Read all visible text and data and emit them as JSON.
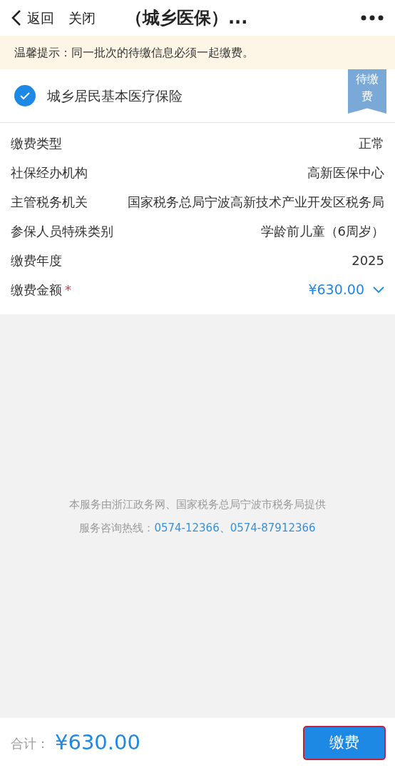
{
  "nav": {
    "back": "返回",
    "close": "关闭",
    "title": "（城乡医保）..."
  },
  "notice": "温馨提示：同一批次的待缴信息必须一起缴费。",
  "item": {
    "name": "城乡居民基本医疗保险",
    "checked": true,
    "ribbon": "待缴费"
  },
  "details": [
    {
      "label": "缴费类型",
      "value": "正常",
      "kind": "plain"
    },
    {
      "label": "社保经办机构",
      "value": "高新医保中心",
      "kind": "plain"
    },
    {
      "label": "主管税务机关",
      "value": "国家税务总局宁波高新技术产业开发区税务局",
      "kind": "plain"
    },
    {
      "label": "参保人员特殊类别",
      "value": "学龄前儿童（6周岁）",
      "kind": "plain"
    },
    {
      "label": "缴费年度",
      "value": "2025",
      "kind": "plain"
    },
    {
      "label": "缴费金额",
      "value": "¥630.00",
      "kind": "amount",
      "required_mark": "*"
    }
  ],
  "footer_note": {
    "line": "本服务由浙江政务网、国家税务总局宁波市税务局提供",
    "hotline_label": "服务咨询热线：",
    "phones": "0574-12366、0574-87912366"
  },
  "bottom_bar": {
    "total_label": "合计：",
    "total": "¥630.00",
    "pay_button": {
      "label": "缴费",
      "highlighted": true
    }
  }
}
